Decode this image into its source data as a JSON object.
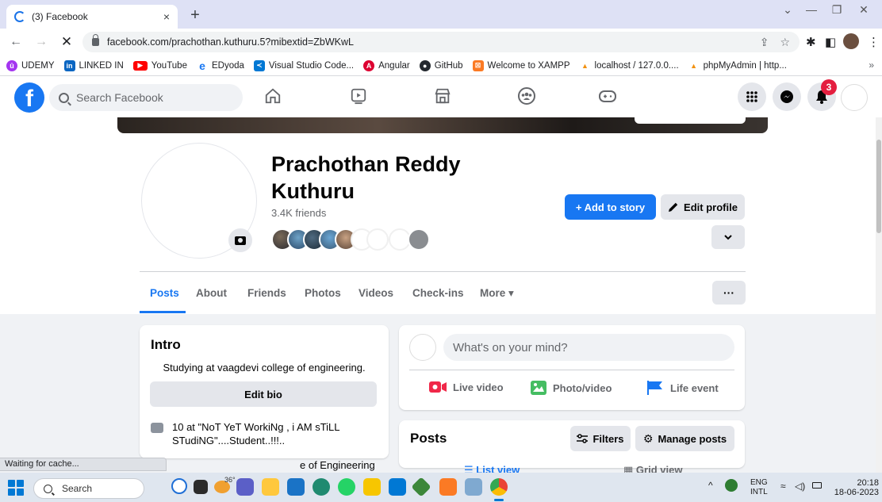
{
  "browser": {
    "tab_title": "(3) Facebook",
    "tab_close": "×",
    "new_tab": "+",
    "url": "facebook.com/prachothan.kuthuru.5?mibextid=ZbWKwL",
    "bookmarks": [
      {
        "label": "UDEMY",
        "color": "#a435f0"
      },
      {
        "label": "LINKED IN",
        "color": "#0a66c2"
      },
      {
        "label": "YouTube",
        "color": "#ff0000"
      },
      {
        "label": "EDyoda",
        "color": "#1877f2"
      },
      {
        "label": "Visual Studio Code...",
        "color": "#0078d4"
      },
      {
        "label": "Angular",
        "color": "#dd0031"
      },
      {
        "label": "GitHub",
        "color": "#24292f"
      },
      {
        "label": "Welcome to XAMPP",
        "color": "#fb7a24"
      },
      {
        "label": "localhost / 127.0.0....",
        "color": "#f29111"
      },
      {
        "label": "phpMyAdmin | http...",
        "color": "#f29111"
      }
    ],
    "bookmarks_more": "»",
    "status_text": "Waiting for cache..."
  },
  "fb": {
    "search_placeholder": "Search Facebook",
    "notification_count": "3",
    "brand_color": "#1877f2"
  },
  "profile": {
    "name": "Prachothan Reddy Kuthuru",
    "friends": "3.4K friends",
    "add_to_story": "+ Add to story",
    "edit_profile": "Edit profile",
    "tabs": [
      "Posts",
      "About",
      "Friends",
      "Photos",
      "Videos",
      "Check-ins",
      "More ▾"
    ],
    "more_dots": "···"
  },
  "intro": {
    "title": "Intro",
    "bio": "Studying at vaagdevi college of engineering.",
    "edit_bio": "Edit bio",
    "work": "10 at \"NoT YeT WorkiNg , i AM sTiLL STudiNG\"....Student..!!!..",
    "college_partial": "e of Engineering"
  },
  "composer": {
    "placeholder": "What's on your mind?",
    "actions": [
      {
        "label": "Live video",
        "color": "#f02849"
      },
      {
        "label": "Photo/video",
        "color": "#45bd62"
      },
      {
        "label": "Life event",
        "color": "#1877f2"
      }
    ]
  },
  "posts": {
    "title": "Posts",
    "filters": "Filters",
    "manage": "Manage posts",
    "list_view": "List view",
    "grid_view": "Grid view"
  },
  "taskbar": {
    "search": "Search",
    "temperature": "36°",
    "lang_top": "ENG",
    "lang_bottom": "INTL",
    "time": "20:18",
    "date": "18-06-2023"
  }
}
